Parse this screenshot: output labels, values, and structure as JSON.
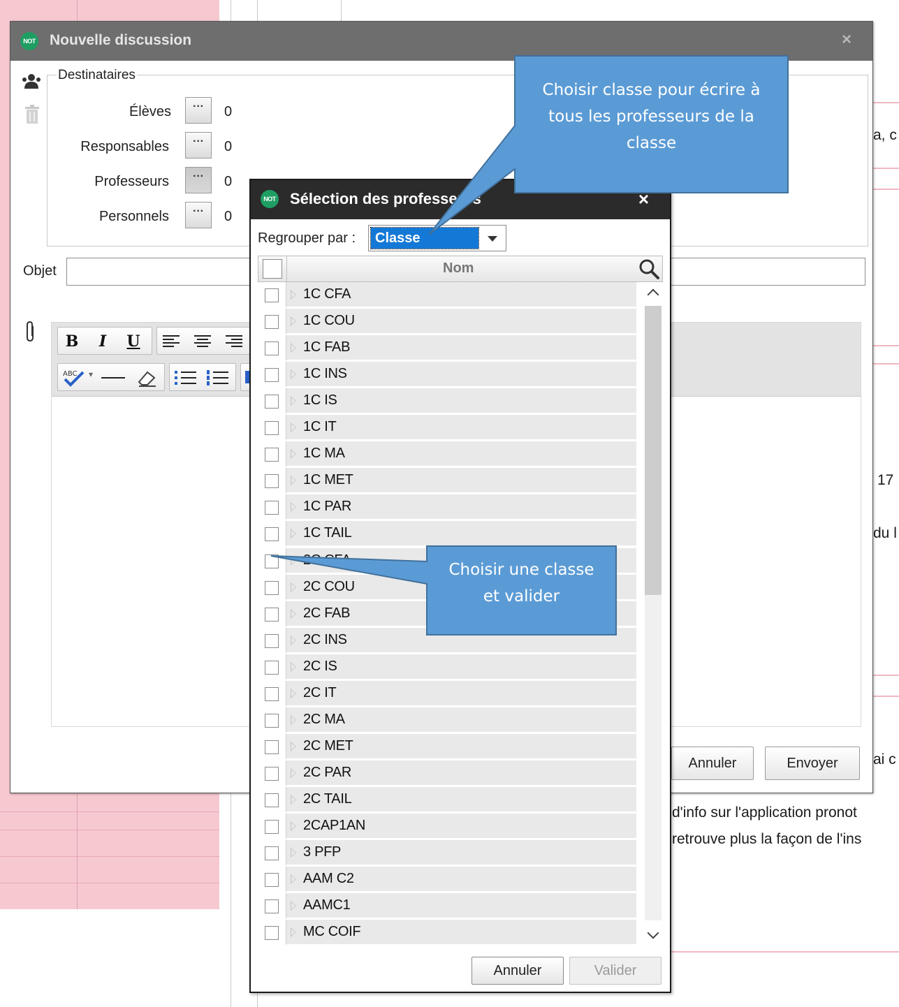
{
  "background": {
    "text_fragments": [
      "a, c",
      "17",
      "du l",
      "ai c",
      "d'info sur l'application pronot",
      "retrouve plus la façon de l'ins"
    ]
  },
  "main_dialog": {
    "logo": "NOT",
    "title": "Nouvelle discussion",
    "close": "×",
    "recipients_legend": "Destinataires",
    "recipients": [
      {
        "label": "Élèves",
        "button": "···",
        "count": "0"
      },
      {
        "label": "Responsables",
        "button": "···",
        "count": "0"
      },
      {
        "label": "Professeurs",
        "button": "···",
        "count": "0"
      },
      {
        "label": "Personnels",
        "button": "···",
        "count": "0"
      }
    ],
    "subject_label": "Objet",
    "subject_value": "",
    "toolbar": {
      "bold": "B",
      "italic": "I",
      "underline": "U"
    },
    "cancel_label": "Annuler",
    "send_label": "Envoyer"
  },
  "selection_dialog": {
    "logo": "NOT",
    "title": "Sélection des professeurs",
    "close": "×",
    "group_by_label": "Regrouper par :",
    "group_by_value": "Classe",
    "column_header": "Nom",
    "classes": [
      "1C CFA",
      "1C COU",
      "1C FAB",
      "1C INS",
      "1C IS",
      "1C IT",
      "1C MA",
      "1C MET",
      "1C PAR",
      "1C TAIL",
      "2C CFA",
      "2C COU",
      "2C FAB",
      "2C INS",
      "2C IS",
      "2C IT",
      "2C MA",
      "2C MET",
      "2C PAR",
      "2C TAIL",
      "2CAP1AN",
      "3 PFP",
      "AAM C2",
      "AAMC1",
      "MC COIF"
    ],
    "cancel_label": "Annuler",
    "validate_label": "Valider"
  },
  "callouts": [
    {
      "lines": [
        "Choisir classe pour écrire à",
        "tous les professeurs de la",
        "classe"
      ]
    },
    {
      "lines": [
        "Choisir une classe",
        "et valider"
      ]
    }
  ],
  "colors": {
    "callout": "#5b9bd5",
    "callout_border": "#41719c",
    "selection_highlight": "#1478d7",
    "not_logo": "#1e9e63",
    "pink_bg": "#f6c9d1"
  }
}
